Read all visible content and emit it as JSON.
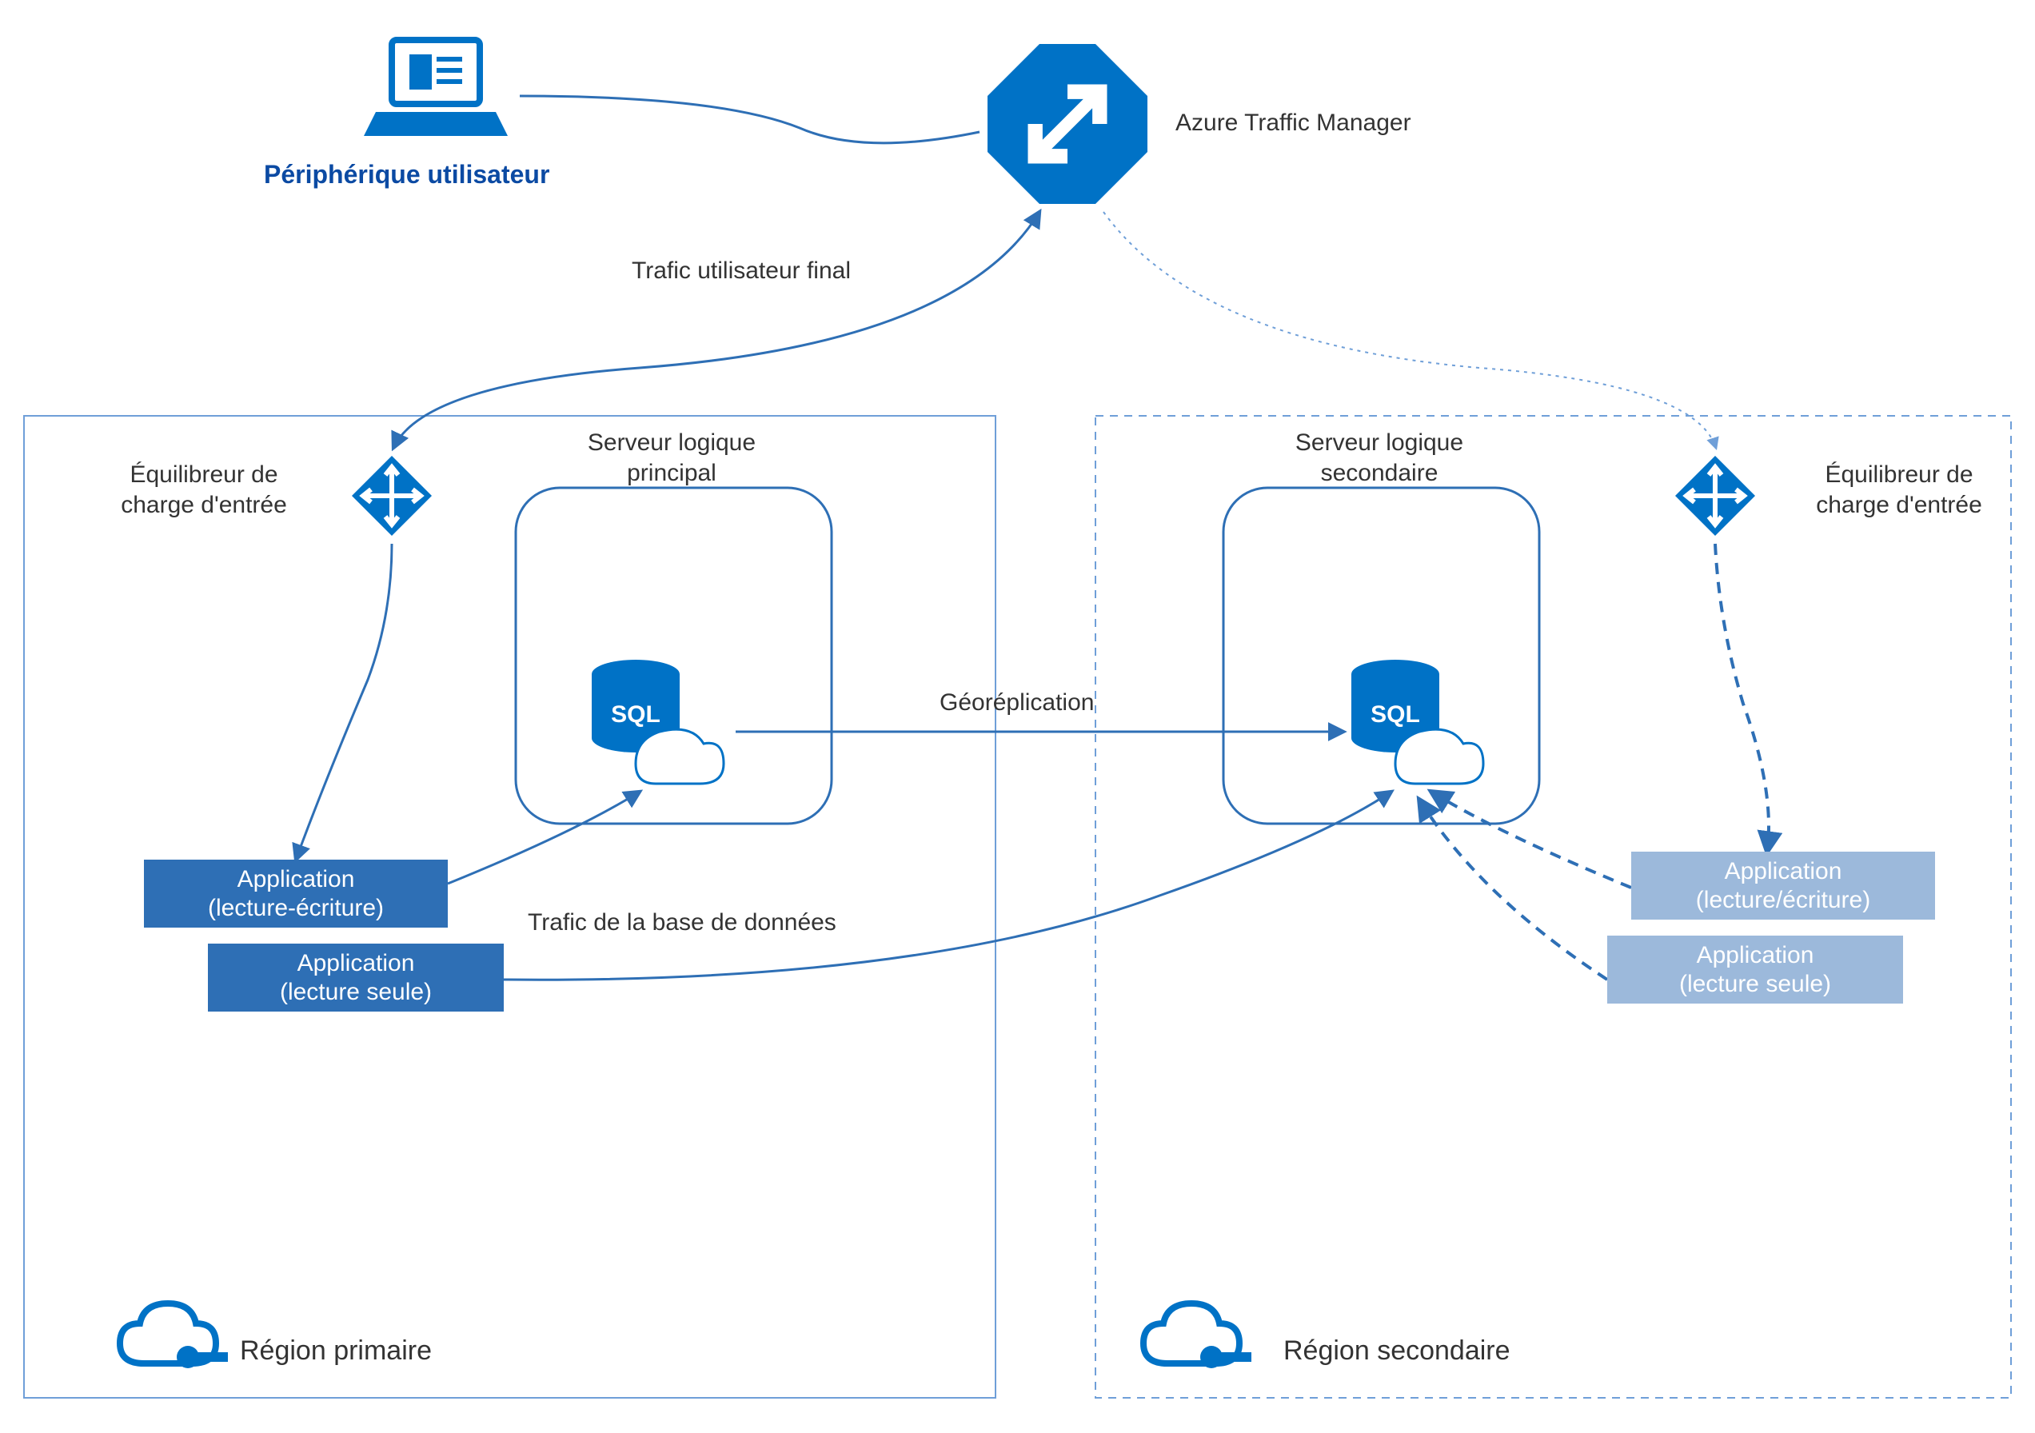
{
  "traffic_manager": {
    "label": "Azure Traffic Manager"
  },
  "user_device": {
    "label": "Périphérique utilisateur"
  },
  "end_user_traffic": {
    "label": "Trafic utilisateur final"
  },
  "db_traffic": {
    "label": "Trafic de la base de données"
  },
  "geo_replication": {
    "label": "Géoréplication"
  },
  "primary": {
    "region": "Région primaire",
    "load_balancer": "Équilibreur de\ncharge d'entrée",
    "server": "Serveur logique\nprincipal",
    "app_rw": "Application\n(lecture-écriture)",
    "app_ro": "Application\n(lecture seule)"
  },
  "secondary": {
    "region": "Région secondaire",
    "load_balancer": "Équilibreur de\ncharge d'entrée",
    "server": "Serveur logique\nsecondaire",
    "app_rw": "Application\n(lecture/écriture)",
    "app_ro": "Application\n(lecture seule)"
  },
  "colors": {
    "azure_blue": "#0072c6",
    "region_border": "#6f9fd8",
    "app_box": "#2e6fb5",
    "app_box_light": "#9cb9db"
  }
}
